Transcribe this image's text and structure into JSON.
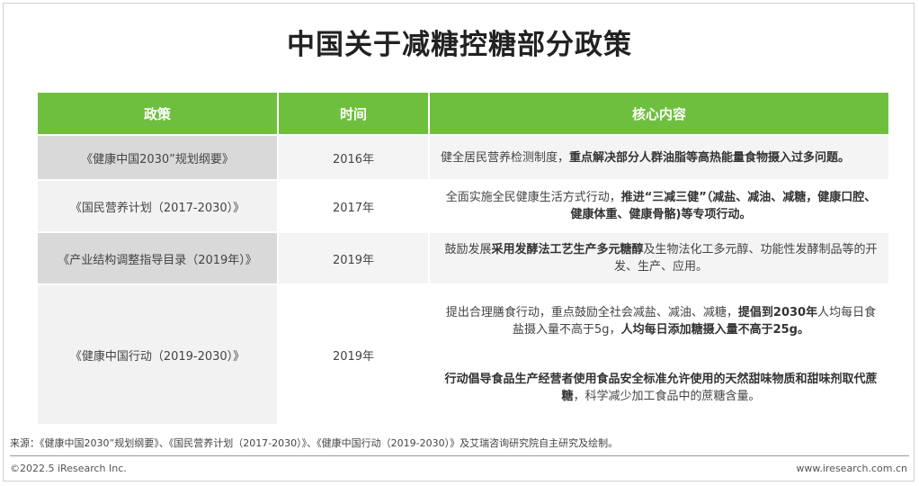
{
  "title": "中国关于减糖控糖部分政策",
  "table": {
    "headers": [
      "政策",
      "时间",
      "核心内容"
    ],
    "rows": [
      {
        "policy": "《健康中国2030”规划纲要》",
        "year": "2016年",
        "content_parts": [
          {
            "text": "健全居民营养检测制度，",
            "bold": false
          },
          {
            "text": "重点解决部分人群油脂等高热能量食物摄入过多问题。",
            "bold": true
          }
        ]
      },
      {
        "policy": "《国民营养计划（2017-2030）》",
        "year": "2017年",
        "content_parts": [
          {
            "text": "全面实施全民健康生活方式行动，",
            "bold": false
          },
          {
            "text": "推进“三减三健”（减盐、减油、减糖，健康口腔、健康体重、健康骨骼)",
            "bold": true
          },
          {
            "text": "等专项行动。",
            "bold": true
          }
        ]
      },
      {
        "policy": "《产业结构调整指导目录（2019年）》",
        "year": "2019年",
        "content_parts": [
          {
            "text": "鼓励发展",
            "bold": false
          },
          {
            "text": "采用发酵法工艺生产多元糖醇",
            "bold": true
          },
          {
            "text": "及生物法化工多元醇、功能性发酵制品等的开发、生产、应用。",
            "bold": false
          }
        ]
      },
      {
        "policy": "《健康中国行动（2019-2030）》",
        "year": "2019年",
        "content_parts": [
          {
            "text": "提出合理膳食行动，重点鼓励全社会减盐、减油、减糖，",
            "bold": false
          },
          {
            "text": "提倡到2030年",
            "bold": true
          },
          {
            "text": "人均每日食盐摄入量不高于5g，",
            "bold": false
          },
          {
            "text": "人均每日添加糖摄入量不高于25g。",
            "bold": true
          }
        ],
        "content_parts_2": [
          {
            "text": "行动倡导食品生产经营者使用食品安全标准允许使用的天然甜味物质和甜味剂取代蔗糖",
            "bold": true
          },
          {
            "text": "，科学减少加工食品中的蔗糖含量。",
            "bold": false
          }
        ]
      }
    ]
  },
  "source": "来源：《健康中国2030”规划纲要》、《国民营养计划（2017-2030）》、《健康中国行动（2019-2030）》及艾瑞咨询研究院自主研究及绘制。",
  "copyright": "©2022.5 iResearch Inc.",
  "website": "www.iresearch.com.cn"
}
